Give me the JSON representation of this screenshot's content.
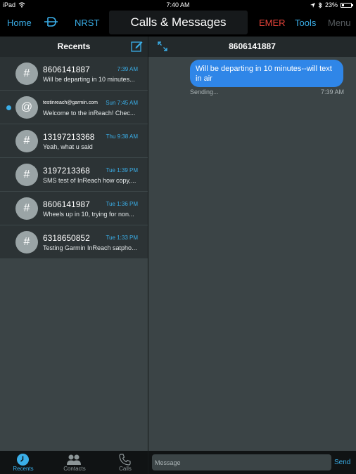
{
  "status_bar": {
    "device": "iPad",
    "time": "7:40 AM",
    "battery": "23%",
    "icons": [
      "wifi-icon",
      "location-icon",
      "bluetooth-icon",
      "battery-icon"
    ]
  },
  "nav": {
    "home": "Home",
    "route_icon": "route-icon",
    "nrst": "NRST",
    "title": "Calls & Messages",
    "emer": "EMER",
    "tools": "Tools",
    "menu": "Menu"
  },
  "recents": {
    "header": "Recents",
    "items": [
      {
        "title": "8606141887",
        "time": "7:39 AM",
        "snippet": "Will be departing in 10 minutes...",
        "avatar": "#",
        "unread": false
      },
      {
        "title": "testinreach@garmin.com",
        "time": "Sun 7:45 AM",
        "snippet": "Welcome to the inReach! Chec...",
        "avatar": "@",
        "unread": true
      },
      {
        "title": "13197213368",
        "time": "Thu 9:38 AM",
        "snippet": "Yeah, what u said",
        "avatar": "#",
        "unread": false
      },
      {
        "title": "3197213368",
        "time": "Tue 1:39 PM",
        "snippet": "SMS test of InReach how copy,...",
        "avatar": "#",
        "unread": false
      },
      {
        "title": "8606141987",
        "time": "Tue 1:36 PM",
        "snippet": "Wheels up in 10, trying for non...",
        "avatar": "#",
        "unread": false
      },
      {
        "title": "6318650852",
        "time": "Tue 1:33 PM",
        "snippet": "Testing Garmin InReach satpho...",
        "avatar": "#",
        "unread": false
      }
    ]
  },
  "conversation": {
    "header": "8606141887",
    "message": {
      "text": "Will be departing in 10 minutes--will text in air",
      "status": "Sending...",
      "time": "7:39 AM"
    },
    "placeholder": "Message",
    "send": "Send"
  },
  "tabs": [
    {
      "label": "Recents",
      "icon": "clock-icon",
      "active": true
    },
    {
      "label": "Contacts",
      "icon": "contacts-icon",
      "active": false
    },
    {
      "label": "Calls",
      "icon": "phone-icon",
      "active": false
    }
  ],
  "colors": {
    "accent": "#3aaee8",
    "emergency": "#e8443a",
    "bubble": "#2f86e8",
    "panel": "#3b4446"
  }
}
